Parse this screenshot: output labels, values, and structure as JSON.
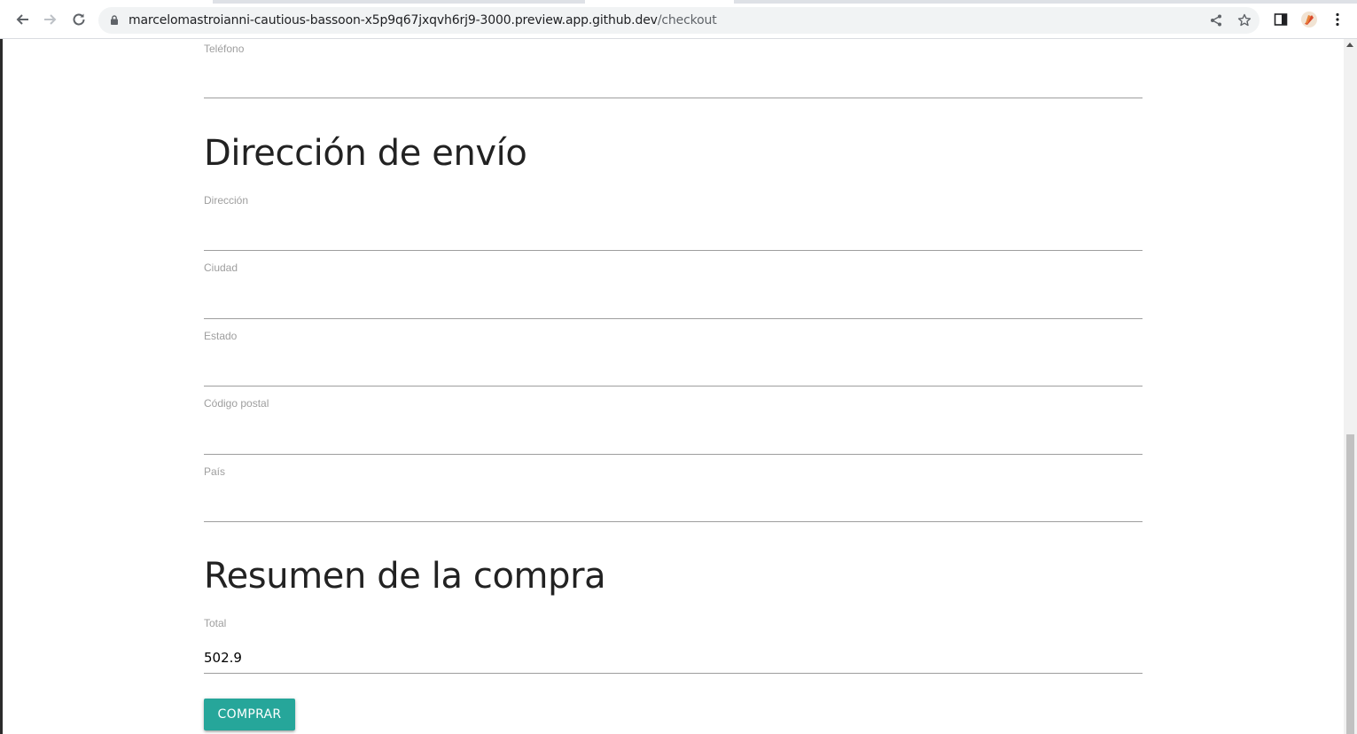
{
  "browser": {
    "url_host": "marcelomastroianni-cautious-bassoon-x5p9q67jxqvh6rj9-3000.preview.app.github.dev",
    "url_path": "/checkout",
    "back_icon": "arrow-left-icon",
    "forward_icon": "arrow-right-icon",
    "reload_icon": "reload-icon",
    "lock_icon": "lock-icon",
    "share_icon": "share-icon",
    "star_icon": "star-icon",
    "sidepanel_icon": "side-panel-icon",
    "extension_icon": "extension-icon",
    "menu_icon": "kebab-menu-icon"
  },
  "form": {
    "telefono": {
      "label": "Teléfono",
      "value": ""
    },
    "shipping_title": "Dirección de envío",
    "direccion": {
      "label": "Dirección",
      "value": ""
    },
    "ciudad": {
      "label": "Ciudad",
      "value": ""
    },
    "estado": {
      "label": "Estado",
      "value": ""
    },
    "codigo_postal": {
      "label": "Código postal",
      "value": ""
    },
    "pais": {
      "label": "País",
      "value": ""
    },
    "summary_title": "Resumen de la compra",
    "total": {
      "label": "Total",
      "value": "502.9"
    },
    "buy_label": "COMPRAR"
  },
  "colors": {
    "accent": "#26a69a",
    "underline": "#9e9e9e",
    "label": "#9e9e9e",
    "heading": "#222222"
  }
}
